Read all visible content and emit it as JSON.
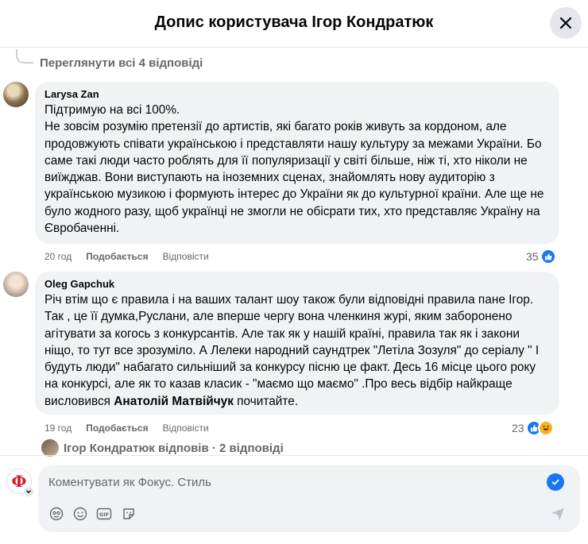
{
  "dialog": {
    "title": "Допис користувача Ігор Кондратюк"
  },
  "thread": {
    "view_all_replies": "Переглянути всі 4 відповіді"
  },
  "comments": [
    {
      "author": "Larysa Zan",
      "text": "Підтримую на всі 100%.\nНе зовсім розумію претензії до артистів, які багато років живуть за кордоном, але продовжують співати українською і представляти нашу культуру за межами України. Бо саме такі люди часто роблять для її популяризації у світі більше, ніж ті, хто ніколи не виїжджав. Вони виступають на іноземних сценах, знайомлять нову аудиторію з українською музикою і формують інтерес до України як до культурної країни. Але ще не було жодного разу, щоб українці не змогли не обісрати тих, хто представляє Україну на Євробаченні.",
      "time": "20 год",
      "like_label": "Подобається",
      "reply_label": "Відповісти",
      "reaction_count": "35"
    },
    {
      "author": "Oleg Gapchuk",
      "text": "Річ втім що є правила і на ваших талант шоу також були відповідні правила пане Ігор. Так , це її думка,Руслани, але вперше чергу вона членкиня журі, яким заборонено агітувати за когось з конкурсантів. Але так як у нашій країні, правила так як і закони ніщо, то тут все зрозуміло. А Лелеки народний саундтрек \"Летіла Зозуля\" до серіалу \" І будуть люди\" набагато сильніший за конкурсу пісню це факт. Десь 16 місце цього року на конкурсі, але як то казав класик - \"маємо що маємо\" .Про весь відбір найкраще висловився",
      "mention": "Анатолій Матвійчук",
      "text_after": " почитайте.",
      "time": "19 год",
      "like_label": "Подобається",
      "reply_label": "Відповісти",
      "reaction_count": "23"
    }
  ],
  "reply_summary": "Ігор Кондратюк відповів · 2 відповіді",
  "composer": {
    "placeholder": "Коментувати як Фокус. Стиль",
    "avatar_letter": "Ф"
  },
  "colors": {
    "like_blue": "#1877f2",
    "bubble_gray": "#f0f2f5",
    "secondary_text": "#65676b",
    "brand_red": "#d6202c"
  },
  "icons": [
    "close-icon",
    "like-icon",
    "haha-icon",
    "avatar-icon",
    "emoji-icon",
    "gif-icon",
    "sticker-icon",
    "send-icon",
    "check-icon",
    "chevron-down-icon"
  ]
}
